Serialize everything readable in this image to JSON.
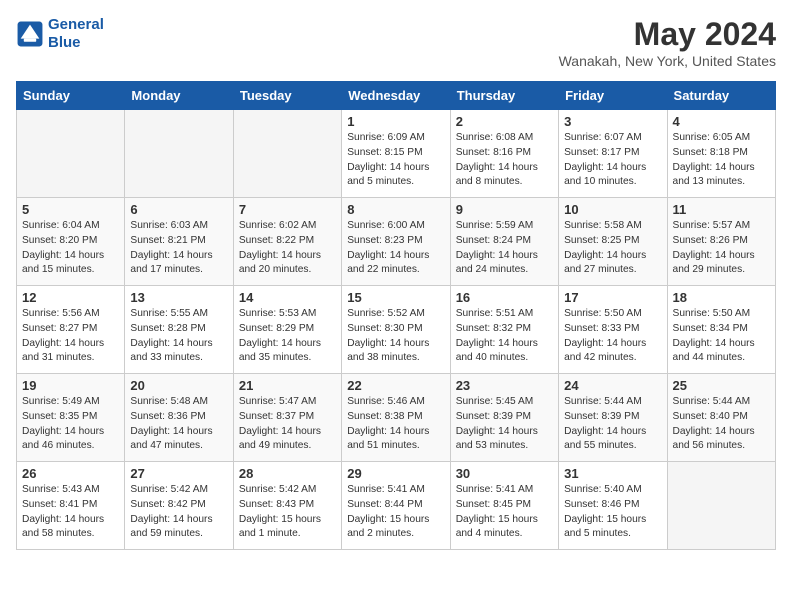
{
  "logo": {
    "line1": "General",
    "line2": "Blue"
  },
  "title": "May 2024",
  "location": "Wanakah, New York, United States",
  "days_of_week": [
    "Sunday",
    "Monday",
    "Tuesday",
    "Wednesday",
    "Thursday",
    "Friday",
    "Saturday"
  ],
  "weeks": [
    [
      {
        "day": "",
        "empty": true
      },
      {
        "day": "",
        "empty": true
      },
      {
        "day": "",
        "empty": true
      },
      {
        "day": "1",
        "sunrise": "6:09 AM",
        "sunset": "8:15 PM",
        "daylight": "14 hours and 5 minutes."
      },
      {
        "day": "2",
        "sunrise": "6:08 AM",
        "sunset": "8:16 PM",
        "daylight": "14 hours and 8 minutes."
      },
      {
        "day": "3",
        "sunrise": "6:07 AM",
        "sunset": "8:17 PM",
        "daylight": "14 hours and 10 minutes."
      },
      {
        "day": "4",
        "sunrise": "6:05 AM",
        "sunset": "8:18 PM",
        "daylight": "14 hours and 13 minutes."
      }
    ],
    [
      {
        "day": "5",
        "sunrise": "6:04 AM",
        "sunset": "8:20 PM",
        "daylight": "14 hours and 15 minutes."
      },
      {
        "day": "6",
        "sunrise": "6:03 AM",
        "sunset": "8:21 PM",
        "daylight": "14 hours and 17 minutes."
      },
      {
        "day": "7",
        "sunrise": "6:02 AM",
        "sunset": "8:22 PM",
        "daylight": "14 hours and 20 minutes."
      },
      {
        "day": "8",
        "sunrise": "6:00 AM",
        "sunset": "8:23 PM",
        "daylight": "14 hours and 22 minutes."
      },
      {
        "day": "9",
        "sunrise": "5:59 AM",
        "sunset": "8:24 PM",
        "daylight": "14 hours and 24 minutes."
      },
      {
        "day": "10",
        "sunrise": "5:58 AM",
        "sunset": "8:25 PM",
        "daylight": "14 hours and 27 minutes."
      },
      {
        "day": "11",
        "sunrise": "5:57 AM",
        "sunset": "8:26 PM",
        "daylight": "14 hours and 29 minutes."
      }
    ],
    [
      {
        "day": "12",
        "sunrise": "5:56 AM",
        "sunset": "8:27 PM",
        "daylight": "14 hours and 31 minutes."
      },
      {
        "day": "13",
        "sunrise": "5:55 AM",
        "sunset": "8:28 PM",
        "daylight": "14 hours and 33 minutes."
      },
      {
        "day": "14",
        "sunrise": "5:53 AM",
        "sunset": "8:29 PM",
        "daylight": "14 hours and 35 minutes."
      },
      {
        "day": "15",
        "sunrise": "5:52 AM",
        "sunset": "8:30 PM",
        "daylight": "14 hours and 38 minutes."
      },
      {
        "day": "16",
        "sunrise": "5:51 AM",
        "sunset": "8:32 PM",
        "daylight": "14 hours and 40 minutes."
      },
      {
        "day": "17",
        "sunrise": "5:50 AM",
        "sunset": "8:33 PM",
        "daylight": "14 hours and 42 minutes."
      },
      {
        "day": "18",
        "sunrise": "5:50 AM",
        "sunset": "8:34 PM",
        "daylight": "14 hours and 44 minutes."
      }
    ],
    [
      {
        "day": "19",
        "sunrise": "5:49 AM",
        "sunset": "8:35 PM",
        "daylight": "14 hours and 46 minutes."
      },
      {
        "day": "20",
        "sunrise": "5:48 AM",
        "sunset": "8:36 PM",
        "daylight": "14 hours and 47 minutes."
      },
      {
        "day": "21",
        "sunrise": "5:47 AM",
        "sunset": "8:37 PM",
        "daylight": "14 hours and 49 minutes."
      },
      {
        "day": "22",
        "sunrise": "5:46 AM",
        "sunset": "8:38 PM",
        "daylight": "14 hours and 51 minutes."
      },
      {
        "day": "23",
        "sunrise": "5:45 AM",
        "sunset": "8:39 PM",
        "daylight": "14 hours and 53 minutes."
      },
      {
        "day": "24",
        "sunrise": "5:44 AM",
        "sunset": "8:39 PM",
        "daylight": "14 hours and 55 minutes."
      },
      {
        "day": "25",
        "sunrise": "5:44 AM",
        "sunset": "8:40 PM",
        "daylight": "14 hours and 56 minutes."
      }
    ],
    [
      {
        "day": "26",
        "sunrise": "5:43 AM",
        "sunset": "8:41 PM",
        "daylight": "14 hours and 58 minutes."
      },
      {
        "day": "27",
        "sunrise": "5:42 AM",
        "sunset": "8:42 PM",
        "daylight": "14 hours and 59 minutes."
      },
      {
        "day": "28",
        "sunrise": "5:42 AM",
        "sunset": "8:43 PM",
        "daylight": "15 hours and 1 minute."
      },
      {
        "day": "29",
        "sunrise": "5:41 AM",
        "sunset": "8:44 PM",
        "daylight": "15 hours and 2 minutes."
      },
      {
        "day": "30",
        "sunrise": "5:41 AM",
        "sunset": "8:45 PM",
        "daylight": "15 hours and 4 minutes."
      },
      {
        "day": "31",
        "sunrise": "5:40 AM",
        "sunset": "8:46 PM",
        "daylight": "15 hours and 5 minutes."
      },
      {
        "day": "",
        "empty": true
      }
    ]
  ]
}
